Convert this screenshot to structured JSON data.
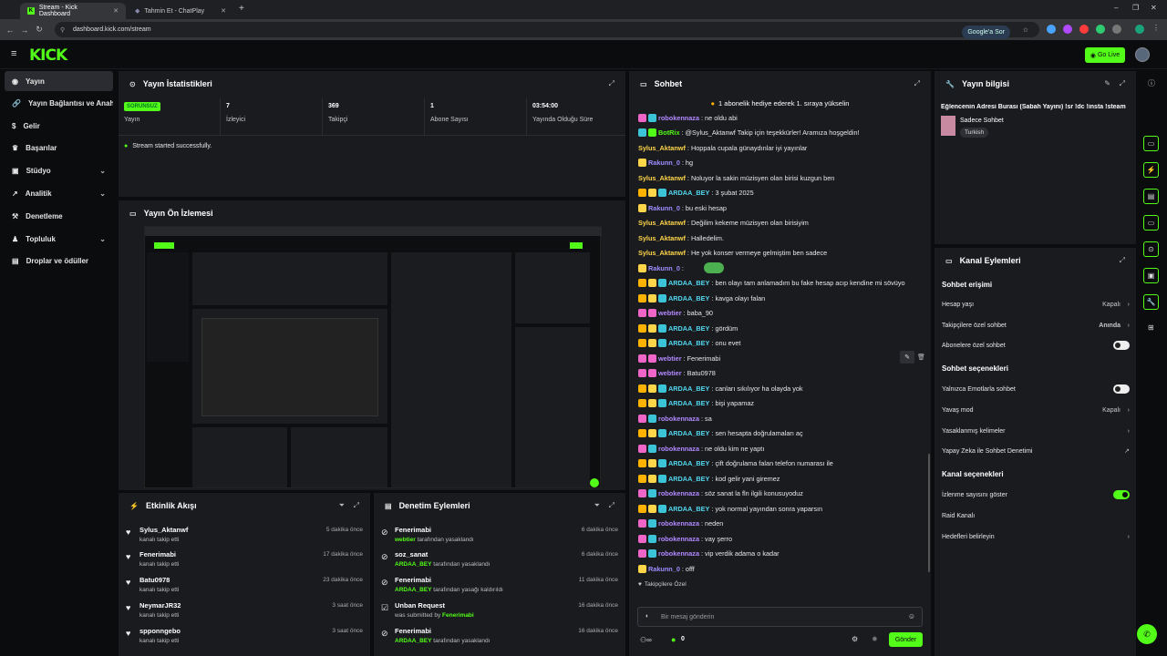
{
  "browser": {
    "tabs": [
      {
        "title": "Stream - Kick Dashboard"
      },
      {
        "title": "Tahmin Et - ChatPlay"
      }
    ],
    "url": "dashboard.kick.com/stream",
    "google_button": "Google'a Sor"
  },
  "header": {
    "logo": "KICK",
    "go_live": "Go Live"
  },
  "sidebar": {
    "items": [
      {
        "label": "Yayın",
        "icon": "broadcast-icon"
      },
      {
        "label": "Yayın Bağlantısı ve Anahtarı",
        "icon": "link-icon"
      },
      {
        "label": "Gelir",
        "icon": "dollar-icon"
      },
      {
        "label": "Başarılar",
        "icon": "trophy-icon"
      },
      {
        "label": "Stüdyo",
        "icon": "studio-icon"
      },
      {
        "label": "Analitik",
        "icon": "chart-icon"
      },
      {
        "label": "Denetleme",
        "icon": "hammer-icon"
      },
      {
        "label": "Topluluk",
        "icon": "community-icon"
      },
      {
        "label": "Droplar ve ödüller",
        "icon": "gift-icon"
      }
    ]
  },
  "stats": {
    "title": "Yayın İstatistikleri",
    "cells": [
      {
        "value": "SORUNSUZ",
        "label": "Yayın"
      },
      {
        "value": "7",
        "label": "İzleyici"
      },
      {
        "value": "369",
        "label": "Takipçi"
      },
      {
        "value": "1",
        "label": "Abone Sayısı"
      },
      {
        "value": "03:54:00",
        "label": "Yayında Olduğu Süre"
      }
    ],
    "status": "Stream started successfully."
  },
  "preview": {
    "title": "Yayın Ön İzlemesi"
  },
  "activity": {
    "title": "Etkinlik Akışı",
    "items": [
      {
        "name": "Sylus_Aktanwf",
        "sub": "kanalı takip etti",
        "time": "5 dakika önce"
      },
      {
        "name": "Fenerimabi",
        "sub": "kanalı takip etti",
        "time": "17 dakika önce"
      },
      {
        "name": "Batu0978",
        "sub": "kanalı takip etti",
        "time": "23 dakika önce"
      },
      {
        "name": "NeymarJR32",
        "sub": "kanalı takip etti",
        "time": "3 saat önce"
      },
      {
        "name": "spponngebo",
        "sub": "kanalı takip etti",
        "time": "3 saat önce"
      }
    ]
  },
  "moderation": {
    "title": "Denetim Eylemleri",
    "items": [
      {
        "name": "Fenerimabi",
        "by": "webtier",
        "action": "tarafından yasaklandı",
        "time": "6 dakika önce"
      },
      {
        "name": "soz_sanat",
        "by": "ARDAA_BEY",
        "action": "tarafından yasaklandı",
        "time": "6 dakika önce"
      },
      {
        "name": "Fenerimabi",
        "by": "ARDAA_BEY",
        "action": "tarafından yasağı kaldırıldı",
        "time": "11 dakika önce"
      },
      {
        "name": "Unban Request",
        "by": "Fenerimabi",
        "action": "was submitted by",
        "time": "16 dakika önce"
      },
      {
        "name": "Fenerimabi",
        "by": "ARDAA_BEY",
        "action": "tarafından yasaklandı",
        "time": "16 dakika önce"
      }
    ]
  },
  "chat": {
    "title": "Sohbet",
    "banner": "1 abonelik hediye ederek 1. sıraya yükselin",
    "messages": [
      {
        "user": "robokennaza",
        "text": "ne oldu abi",
        "color": "#b388ff",
        "badges": [
          "vip",
          "sub"
        ]
      },
      {
        "user": "BotRix",
        "text": "@Sylus_Aktanwf Takip için teşekkürler! Aramıza hoşgeldin!",
        "color": "#53fc18",
        "badges": [
          "sub",
          "mod"
        ]
      },
      {
        "user": "Sylus_Aktanwf",
        "text": "Hoppala cupala günaydınlar iyi yayınlar",
        "color": "#ffd54a",
        "badges": []
      },
      {
        "user": "Rakunn_0",
        "text": "hg",
        "color": "#9f8cff",
        "badges": [
          "og"
        ]
      },
      {
        "user": "Sylus_Aktanwf",
        "text": "Noluyor la sakin müzisyen olan birisi kuzgun ben",
        "color": "#ffd54a",
        "badges": []
      },
      {
        "user": "ARDAA_BEY",
        "text": "3 şubat 2025",
        "color": "#53d8f0",
        "badges": [
          "crown",
          "og",
          "sub"
        ]
      },
      {
        "user": "Rakunn_0",
        "text": "bu eski hesap",
        "color": "#9f8cff",
        "badges": [
          "og"
        ]
      },
      {
        "user": "Sylus_Aktanwf",
        "text": "Değilim kekeme müzisyen olan birisiyim",
        "color": "#ffd54a",
        "badges": []
      },
      {
        "user": "Sylus_Aktanwf",
        "text": "Halledelim.",
        "color": "#ffd54a",
        "badges": []
      },
      {
        "user": "Sylus_Aktanwf",
        "text": "He yok konser vermeye gelmiştim ben sadece",
        "color": "#ffd54a",
        "badges": []
      },
      {
        "user": "Rakunn_0",
        "text": "",
        "color": "#9f8cff",
        "badges": [
          "og"
        ],
        "emote": true
      },
      {
        "user": "ARDAA_BEY",
        "text": "ben olayı tam anlamadım bu fake hesap acıp kendine mi sövüyo",
        "color": "#53d8f0",
        "badges": [
          "crown",
          "og",
          "sub"
        ]
      },
      {
        "user": "ARDAA_BEY",
        "text": "kavga olayı falan",
        "color": "#53d8f0",
        "badges": [
          "crown",
          "og",
          "sub"
        ]
      },
      {
        "user": "webtier",
        "text": "baba_90",
        "color": "#b388ff",
        "badges": [
          "vip",
          "mic"
        ]
      },
      {
        "user": "ARDAA_BEY",
        "text": "gördüm",
        "color": "#53d8f0",
        "badges": [
          "crown",
          "og",
          "sub"
        ]
      },
      {
        "user": "ARDAA_BEY",
        "text": "onu evet",
        "color": "#53d8f0",
        "badges": [
          "crown",
          "og",
          "sub"
        ]
      },
      {
        "user": "webtier",
        "text": "Fenerimabi",
        "color": "#b388ff",
        "badges": [
          "vip",
          "mic"
        ]
      },
      {
        "user": "webtier",
        "text": "Batu0978",
        "color": "#b388ff",
        "badges": [
          "vip",
          "mic"
        ]
      },
      {
        "user": "ARDAA_BEY",
        "text": "canları sıkılıyor ha olayda yok",
        "color": "#53d8f0",
        "badges": [
          "crown",
          "og",
          "sub"
        ]
      },
      {
        "user": "ARDAA_BEY",
        "text": "bişi yapamaz",
        "color": "#53d8f0",
        "badges": [
          "crown",
          "og",
          "sub"
        ]
      },
      {
        "user": "robokennaza",
        "text": "sa",
        "color": "#b388ff",
        "badges": [
          "vip",
          "sub"
        ]
      },
      {
        "user": "ARDAA_BEY",
        "text": "sen hesapta doğrulamaları aç",
        "color": "#53d8f0",
        "badges": [
          "crown",
          "og",
          "sub"
        ]
      },
      {
        "user": "robokennaza",
        "text": "ne oldu kim ne yaptı",
        "color": "#b388ff",
        "badges": [
          "vip",
          "sub"
        ]
      },
      {
        "user": "ARDAA_BEY",
        "text": "çift doğrulama falan telefon numarası ile",
        "color": "#53d8f0",
        "badges": [
          "crown",
          "og",
          "sub"
        ]
      },
      {
        "user": "ARDAA_BEY",
        "text": "kod gelir yani giremez",
        "color": "#53d8f0",
        "badges": [
          "crown",
          "og",
          "sub"
        ]
      },
      {
        "user": "robokennaza",
        "text": "söz sanat la fln ilgili konusuyoduz",
        "color": "#b388ff",
        "badges": [
          "vip",
          "sub"
        ]
      },
      {
        "user": "ARDAA_BEY",
        "text": "yok normal yayından sonra yaparsın",
        "color": "#53d8f0",
        "badges": [
          "crown",
          "og",
          "sub"
        ]
      },
      {
        "user": "robokennaza",
        "text": "neden",
        "color": "#b388ff",
        "badges": [
          "vip",
          "sub"
        ]
      },
      {
        "user": "robokennaza",
        "text": "vay şerro",
        "color": "#b388ff",
        "badges": [
          "vip",
          "sub"
        ]
      },
      {
        "user": "robokennaza",
        "text": "vip verdik adama o kadar",
        "color": "#b388ff",
        "badges": [
          "vip",
          "sub"
        ]
      },
      {
        "user": "Rakunn_0",
        "text": "offf",
        "color": "#9f8cff",
        "badges": [
          "og"
        ]
      }
    ],
    "followers_only": "Takipçilere Özel",
    "input_placeholder": "Bir mesaj gönderin",
    "points": "0",
    "send": "Gönder"
  },
  "info": {
    "title": "Yayın bilgisi",
    "stream_title": "Eğlencenin Adresi Burası (Sabah Yayını) !sr !dc !insta !steam",
    "category": "Sadece Sohbet",
    "tag": "Turkish"
  },
  "channel_actions": {
    "title": "Kanal Eylemleri",
    "chat_access_title": "Sohbet erişimi",
    "account_age": {
      "label": "Hesap yaşı",
      "value": "Kapalı"
    },
    "followers_chat": {
      "label": "Takipçilere özel sohbet",
      "value": "Anında"
    },
    "subs_chat": {
      "label": "Abonelere özel sohbet",
      "on": false
    },
    "chat_options_title": "Sohbet seçenekleri",
    "emote_only": {
      "label": "Yalnızca Emotlarla sohbet",
      "on": false
    },
    "slow_mode": {
      "label": "Yavaş mod",
      "value": "Kapalı"
    },
    "banned_words": {
      "label": "Yasaklanmış kelimeler"
    },
    "ai_moderation": {
      "label": "Yapay Zeka ile Sohbet Denetimi"
    },
    "channel_options_title": "Kanal seçenekleri",
    "show_viewers": {
      "label": "İzlenme sayısını göster",
      "on": true
    },
    "raid": {
      "label": "Raid Kanalı"
    },
    "goals": {
      "label": "Hedefleri belirleyin"
    }
  },
  "colors": {
    "accent": "#53fc18",
    "panel": "#191b1f",
    "background": "#0b0c0e"
  }
}
